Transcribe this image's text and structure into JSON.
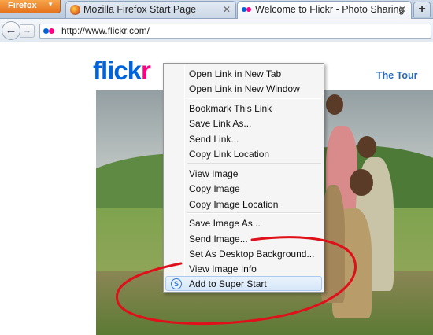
{
  "browser": {
    "app_button_label": "Firefox",
    "tabs": [
      {
        "title": "Mozilla Firefox Start Page",
        "active": false
      },
      {
        "title": "Welcome to Flickr - Photo Sharing",
        "active": true
      }
    ],
    "new_tab_label": "+",
    "url": "http://www.flickr.com/"
  },
  "page": {
    "logo_part1": "flick",
    "logo_part2": "r",
    "tour_link": "The Tour"
  },
  "context_menu": {
    "items": [
      {
        "label": "Open Link in New Tab"
      },
      {
        "label": "Open Link in New Window"
      },
      {
        "label": "Bookmark This Link"
      },
      {
        "label": "Save Link As..."
      },
      {
        "label": "Send Link..."
      },
      {
        "label": "Copy Link Location"
      },
      {
        "label": "View Image"
      },
      {
        "label": "Copy Image"
      },
      {
        "label": "Copy Image Location"
      },
      {
        "label": "Save Image As..."
      },
      {
        "label": "Send Image..."
      },
      {
        "label": "Set As Desktop Background..."
      },
      {
        "label": "View Image Info"
      },
      {
        "label": "Add to Super Start",
        "highlighted": true,
        "icon": "super-start-icon"
      }
    ]
  },
  "colors": {
    "flickr_blue": "#0063dc",
    "flickr_pink": "#ff0084",
    "annotation": "#e0101a"
  }
}
